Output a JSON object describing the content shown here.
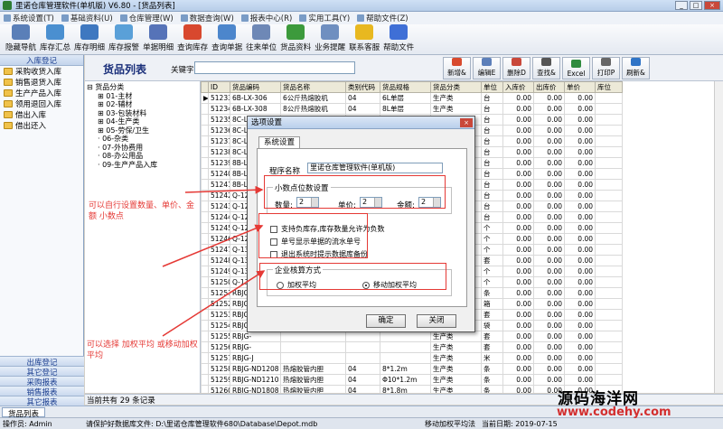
{
  "window": {
    "title": "里诺仓库管理软件(单机版) V6.80 - [货品列表]"
  },
  "menu": [
    "系统设置(T)",
    "基础资料(U)",
    "仓库管理(W)",
    "数据查询(W)",
    "报表中心(R)",
    "实用工具(Y)",
    "帮助文件(Z)"
  ],
  "toolbar": [
    {
      "label": "隐藏导航",
      "color": "#5a7fb8"
    },
    {
      "label": "库存汇总",
      "color": "#4a8fd0"
    },
    {
      "label": "库存明细",
      "color": "#3f78c0"
    },
    {
      "label": "库存报警",
      "color": "#5aa0d8"
    },
    {
      "label": "单据明细",
      "color": "#5673b8"
    },
    {
      "label": "查询库存",
      "color": "#d8482e"
    },
    {
      "label": "查询单据",
      "color": "#4c86cc"
    },
    {
      "label": "往来单位",
      "color": "#6e88b6"
    },
    {
      "label": "货品资料",
      "color": "#3c9a3c"
    },
    {
      "label": "业务提醒",
      "color": "#6f8fc0"
    },
    {
      "label": "联系客服",
      "color": "#e8b820"
    },
    {
      "label": "帮助文件",
      "color": "#3f6fd6"
    }
  ],
  "sidebar": {
    "header": "入库登记",
    "items": [
      "采购收货入库",
      "销售退货入库",
      "生产产品入库",
      "领用退回入库",
      "借出入库",
      "借出还入"
    ],
    "bottom": [
      "出库登记",
      "其它登记",
      "采购报表",
      "销售报表",
      "其它报表"
    ]
  },
  "panel": {
    "title": "货品列表",
    "keyword_label": "关键字",
    "keyword_value": ""
  },
  "actions": [
    {
      "label": "新增&",
      "color": "#d84a2e"
    },
    {
      "label": "编辑E",
      "color": "#5d7fb9"
    },
    {
      "label": "删除D",
      "color": "#c9483a"
    },
    {
      "label": "查找&",
      "color": "#555"
    },
    {
      "label": "Excel",
      "color": "#2e8b3e"
    },
    {
      "label": "打印P",
      "color": "#666"
    },
    {
      "label": "刷新&",
      "color": "#2f74c6"
    }
  ],
  "tree": [
    "货品分类",
    "01-主材",
    "02-辅材",
    "03-包装材料",
    "04-生产类",
    "05-劳保/卫生",
    "06-杂类",
    "07-外协费用",
    "08-办公用品",
    "09-生产产品入库"
  ],
  "table": {
    "headers": [
      "",
      "ID",
      "货品编码",
      "货品名称",
      "类别代码",
      "货品规格",
      "货品分类",
      "单位",
      "入库价",
      "出库价",
      "单价",
      "库位"
    ],
    "rows": [
      [
        "▶",
        "51233",
        "6B-LX-306",
        "6公斤热熔胶机",
        "04",
        "6L单层",
        "生产类",
        "台",
        "0.00",
        "0.00",
        "0.00",
        ""
      ],
      [
        "",
        "51234",
        "6B-LX-308",
        "8公斤热熔胶机",
        "04",
        "8L单层",
        "生产类",
        "台",
        "0.00",
        "0.00",
        "0.00",
        ""
      ],
      [
        "",
        "51235",
        "8C-LX",
        "",
        "04",
        "",
        "生产类",
        "台",
        "0.00",
        "0.00",
        "0.00",
        ""
      ],
      [
        "",
        "51236",
        "8C-LX",
        "",
        "",
        "",
        "生产产品入库",
        "台",
        "0.00",
        "0.00",
        "0.00",
        ""
      ],
      [
        "",
        "51237",
        "8C-LX",
        "",
        "",
        "",
        "生产产品入库",
        "台",
        "0.00",
        "0.00",
        "0.00",
        ""
      ],
      [
        "",
        "51238",
        "8C-LX",
        "",
        "",
        "",
        "生产类",
        "台",
        "0.00",
        "0.00",
        "0.00",
        ""
      ],
      [
        "",
        "51239",
        "8B-LX",
        "",
        "",
        "",
        "生产类",
        "台",
        "0.00",
        "0.00",
        "0.00",
        ""
      ],
      [
        "",
        "51240",
        "8B-LX",
        "",
        "",
        "",
        "生产类",
        "台",
        "0.00",
        "0.00",
        "0.00",
        ""
      ],
      [
        "",
        "51241",
        "8B-LX",
        "",
        "",
        "",
        "生产类",
        "台",
        "0.00",
        "0.00",
        "0.00",
        ""
      ],
      [
        "",
        "51242",
        "Q-120",
        "",
        "",
        "",
        "生产类",
        "台",
        "0.00",
        "0.00",
        "0.00",
        ""
      ],
      [
        "",
        "51243",
        "Q-120",
        "",
        "",
        "",
        "生产类",
        "台",
        "0.00",
        "0.00",
        "0.00",
        ""
      ],
      [
        "",
        "51244",
        "Q-121",
        "",
        "",
        "",
        "生产类",
        "台",
        "0.00",
        "0.00",
        "0.00",
        ""
      ],
      [
        "",
        "51245",
        "Q-121",
        "",
        "",
        "",
        "起重及附件",
        "个",
        "0.00",
        "0.00",
        "0.00",
        ""
      ],
      [
        "",
        "51246",
        "Q-121",
        "",
        "",
        "",
        "生产类",
        "个",
        "0.00",
        "0.00",
        "0.00",
        ""
      ],
      [
        "",
        "51247",
        "Q-131",
        "",
        "",
        "",
        "生产类",
        "个",
        "0.00",
        "0.00",
        "0.00",
        ""
      ],
      [
        "",
        "51248",
        "Q-131",
        "",
        "",
        "",
        "生产类",
        "套",
        "0.00",
        "0.00",
        "0.00",
        ""
      ],
      [
        "",
        "51249",
        "Q-131",
        "",
        "",
        "",
        "生产类",
        "个",
        "0.00",
        "0.00",
        "0.00",
        ""
      ],
      [
        "",
        "51250",
        "Q-131",
        "",
        "",
        "",
        "生产类",
        "个",
        "0.00",
        "0.00",
        "0.00",
        ""
      ],
      [
        "",
        "51251",
        "RBJG-",
        "",
        "",
        "",
        "生产类",
        "条",
        "0.00",
        "0.00",
        "0.00",
        ""
      ],
      [
        "",
        "51252",
        "RBJG-",
        "",
        "",
        "",
        "生产类",
        "箱",
        "0.00",
        "0.00",
        "0.00",
        ""
      ],
      [
        "",
        "51253",
        "RBJG-",
        "",
        "",
        "",
        "生产类",
        "套",
        "0.00",
        "0.00",
        "0.00",
        ""
      ],
      [
        "",
        "51254",
        "RBJG-",
        "",
        "",
        "",
        "生产类",
        "袋",
        "0.00",
        "0.00",
        "0.00",
        ""
      ],
      [
        "",
        "51255",
        "RBJG-",
        "",
        "",
        "",
        "生产类",
        "套",
        "0.00",
        "0.00",
        "0.00",
        ""
      ],
      [
        "",
        "51256",
        "RBJG-",
        "",
        "",
        "",
        "生产类",
        "套",
        "0.00",
        "0.00",
        "0.00",
        ""
      ],
      [
        "",
        "51257",
        "RBJG-J",
        "",
        "",
        "",
        "生产类",
        "米",
        "0.00",
        "0.00",
        "0.00",
        ""
      ],
      [
        "",
        "51258",
        "RBJG-ND1208",
        "热熔胶管内胆",
        "04",
        "8*1.2m",
        "生产类",
        "条",
        "0.00",
        "0.00",
        "0.00",
        ""
      ],
      [
        "",
        "51259",
        "RBJG-ND1210",
        "热熔胶管内胆",
        "04",
        "Φ10*1.2m",
        "生产类",
        "条",
        "0.00",
        "0.00",
        "0.00",
        ""
      ],
      [
        "",
        "51260",
        "RBJG-ND1808",
        "热熔胶管内胆",
        "04",
        "8*1.8m",
        "生产类",
        "条",
        "0.00",
        "0.00",
        "0.00",
        ""
      ],
      [
        "",
        "51261",
        "RBJG-ND1810",
        "热熔胶管内胆",
        "04",
        "Φ10*1.8m",
        "生产类",
        "条",
        "0.00",
        "0.00",
        "0.00",
        ""
      ]
    ]
  },
  "count": "当前共有 29 条记录",
  "tabs": [
    "货品列表"
  ],
  "status": {
    "operator": "操作员: Admin",
    "db": "请保护好数据库文件: D:\\里诺仓库管理软件680\\Database\\Depot.mdb",
    "method": "移动加权平均法",
    "date": "当前日期: 2019-07-15"
  },
  "dialog": {
    "title": "选项设置",
    "tab": "系统设置",
    "prog_label": "程序名称",
    "prog_value": "里诺仓库管理软件(单机版)",
    "decimal_group": "小数点位数设置",
    "qty_label": "数量:",
    "qty_value": "2",
    "price_label": "单价:",
    "price_value": "2",
    "amount_label": "金额:",
    "amount_value": "2",
    "checks": [
      "支持负库存,库存数量允许为负数",
      "单号显示单据的流水单号",
      "退出系统时提示数据库备份"
    ],
    "costing_group": "企业核算方式",
    "radio1": "加权平均",
    "radio2": "移动加权平均",
    "ok": "确定",
    "close": "关闭"
  },
  "notes": {
    "n1": "可以自行设置数量、单价、金额 小数点",
    "n2": "可以选择 加权平均 或移动加权平均"
  },
  "watermark": {
    "line1": "源码海洋网",
    "line2": "www.codehy.com"
  }
}
